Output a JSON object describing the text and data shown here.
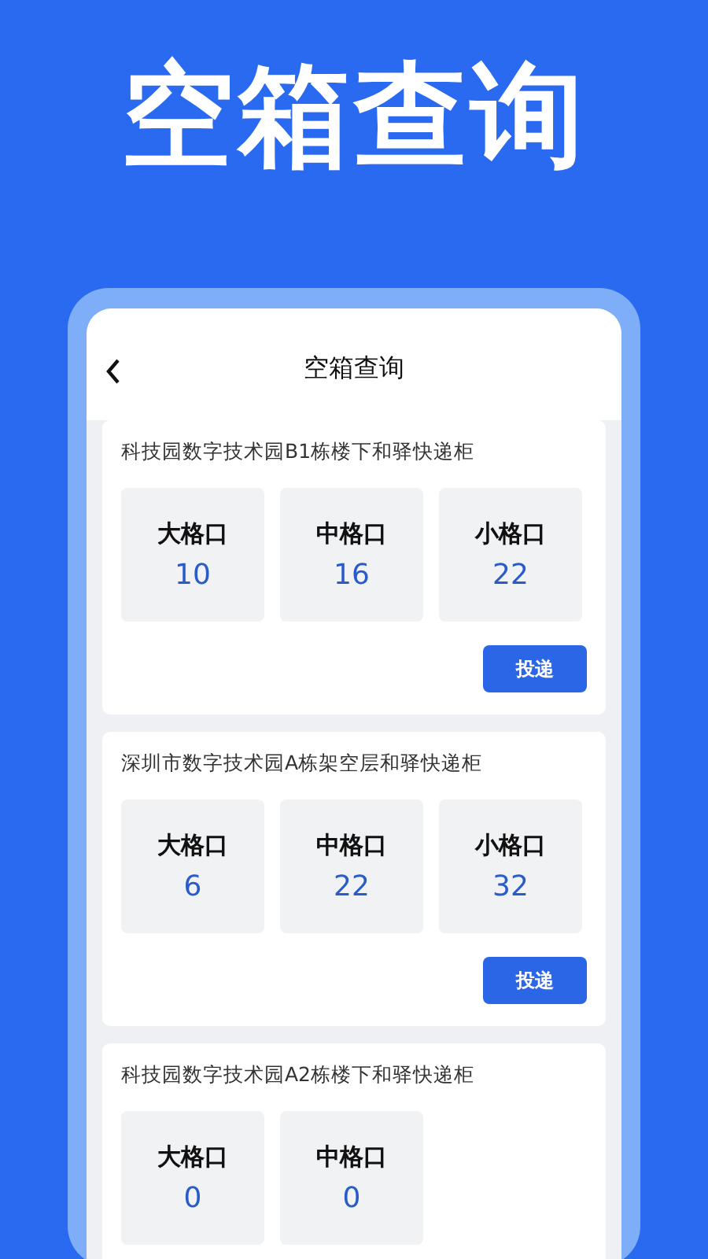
{
  "headline": "空箱查询",
  "screen": {
    "title": "空箱查询"
  },
  "lockers": [
    {
      "name": "科技园数字技术园B1栋楼下和驿快递柜",
      "slots": [
        {
          "label": "大格口",
          "count": "10"
        },
        {
          "label": "中格口",
          "count": "16"
        },
        {
          "label": "小格口",
          "count": "22"
        }
      ],
      "button": "投递"
    },
    {
      "name": "深圳市数字技术园A栋架空层和驿快递柜",
      "slots": [
        {
          "label": "大格口",
          "count": "6"
        },
        {
          "label": "中格口",
          "count": "22"
        },
        {
          "label": "小格口",
          "count": "32"
        }
      ],
      "button": "投递"
    },
    {
      "name": "科技园数字技术园A2栋楼下和驿快递柜",
      "slots": [
        {
          "label": "大格口",
          "count": "0"
        },
        {
          "label": "中格口",
          "count": "0"
        }
      ]
    }
  ]
}
